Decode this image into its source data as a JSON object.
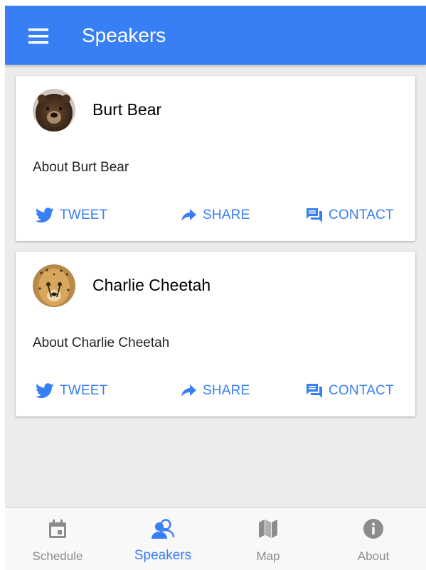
{
  "colors": {
    "primary": "#387ef5",
    "tab_inactive": "#8c8c8c",
    "background": "#ececec"
  },
  "toolbar": {
    "title": "Speakers",
    "menu_icon": "menu-icon"
  },
  "speakers": [
    {
      "name": "Burt Bear",
      "about": "About Burt Bear",
      "avatar": "bear-photo",
      "actions": {
        "tweet": "TWEET",
        "share": "SHARE",
        "contact": "CONTACT"
      }
    },
    {
      "name": "Charlie Cheetah",
      "about": "About Charlie Cheetah",
      "avatar": "cheetah-photo",
      "actions": {
        "tweet": "TWEET",
        "share": "SHARE",
        "contact": "CONTACT"
      }
    }
  ],
  "tabs": [
    {
      "label": "Schedule",
      "icon": "calendar-icon",
      "active": false
    },
    {
      "label": "Speakers",
      "icon": "contacts-icon",
      "active": true
    },
    {
      "label": "Map",
      "icon": "map-icon",
      "active": false
    },
    {
      "label": "About",
      "icon": "info-icon",
      "active": false
    }
  ]
}
